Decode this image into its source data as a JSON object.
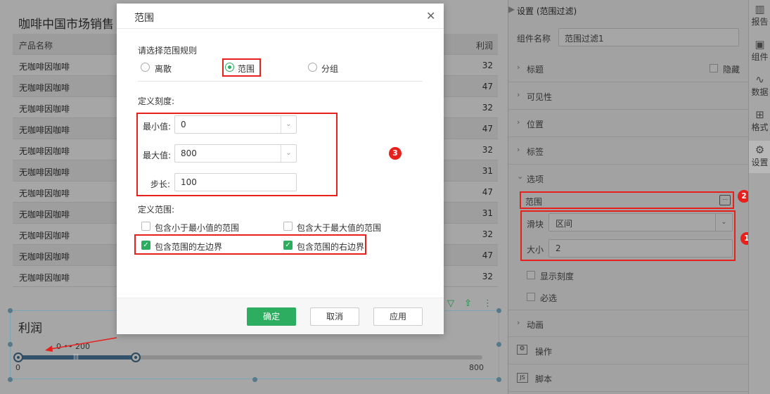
{
  "report": {
    "title": "咖啡中国市场销售",
    "table": {
      "headers": [
        "产品名称",
        "利润"
      ],
      "rows": [
        [
          "无咖啡因咖啡",
          "32"
        ],
        [
          "无咖啡因咖啡",
          "47"
        ],
        [
          "无咖啡因咖啡",
          "32"
        ],
        [
          "无咖啡因咖啡",
          "47"
        ],
        [
          "无咖啡因咖啡",
          "32"
        ],
        [
          "无咖啡因咖啡",
          "31"
        ],
        [
          "无咖啡因咖啡",
          "47"
        ],
        [
          "无咖啡因咖啡",
          "31"
        ],
        [
          "无咖啡因咖啡",
          "32"
        ],
        [
          "无咖啡因咖啡",
          "47"
        ],
        [
          "无咖啡因咖啡",
          "32"
        ]
      ]
    },
    "widget": {
      "title": "利润",
      "range_label": "0 •• 200",
      "min_label": "0",
      "max_label": "800",
      "range_start": 0,
      "range_end": 200,
      "range_max": 800
    }
  },
  "dialog": {
    "title": "范围",
    "rule_prompt": "请选择范围规则",
    "rules": [
      "离散",
      "范围",
      "分组"
    ],
    "selected_rule": "范围",
    "scale_label": "定义刻度:",
    "min_label": "最小值:",
    "min_value": "0",
    "max_label": "最大值:",
    "max_value": "800",
    "step_label": "步长:",
    "step_value": "100",
    "range_label": "定义范围:",
    "options": [
      {
        "label": "包含小于最小值的范围",
        "checked": false
      },
      {
        "label": "包含大于最大值的范围",
        "checked": false
      },
      {
        "label": "包含范围的左边界",
        "checked": true
      },
      {
        "label": "包含范围的右边界",
        "checked": true
      }
    ],
    "buttons": {
      "ok": "确定",
      "cancel": "取消",
      "apply": "应用"
    }
  },
  "panel": {
    "header": "设置 (范围过滤)",
    "component_name_label": "组件名称",
    "component_name_value": "范围过滤1",
    "sections": {
      "title": "标题",
      "hide": "隐藏",
      "visibility": "可见性",
      "position": "位置",
      "labels": "标签",
      "options": "选项",
      "animation": "动画",
      "operation": "操作",
      "script": "脚本"
    },
    "range_field": "范围",
    "slider_label": "滑块",
    "slider_value": "区间",
    "size_label": "大小",
    "size_value": "2",
    "show_scale": "显示刻度",
    "required": "必选"
  },
  "sidebar": [
    "报告",
    "组件",
    "数据",
    "格式",
    "设置"
  ],
  "annotations": [
    "1",
    "2",
    "3"
  ],
  "colors": {
    "accent_green": "#2dad5f",
    "annotation_red": "#e8201c"
  }
}
